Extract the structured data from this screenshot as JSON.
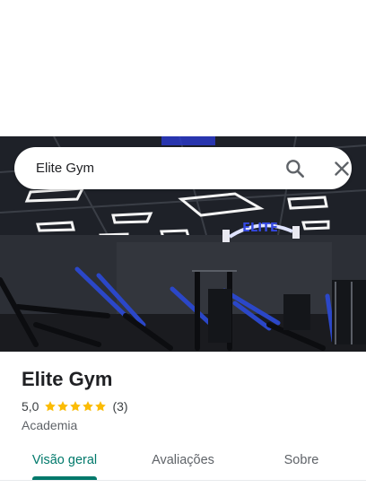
{
  "search": {
    "query": "Elite Gym"
  },
  "photo": {
    "logo_text": "ELITE"
  },
  "place": {
    "name": "Elite Gym",
    "rating": "5,0",
    "stars": 5,
    "review_count": "(3)",
    "category": "Academia"
  },
  "tabs": [
    {
      "label": "Visão geral",
      "active": true
    },
    {
      "label": "Avaliações",
      "active": false
    },
    {
      "label": "Sobre",
      "active": false
    }
  ],
  "colors": {
    "accent": "#00796b",
    "star": "#fbbc04",
    "text": "#202124",
    "muted": "#5f6368"
  },
  "icons": {
    "search": "search-icon",
    "close": "close-icon",
    "star": "star-icon"
  }
}
